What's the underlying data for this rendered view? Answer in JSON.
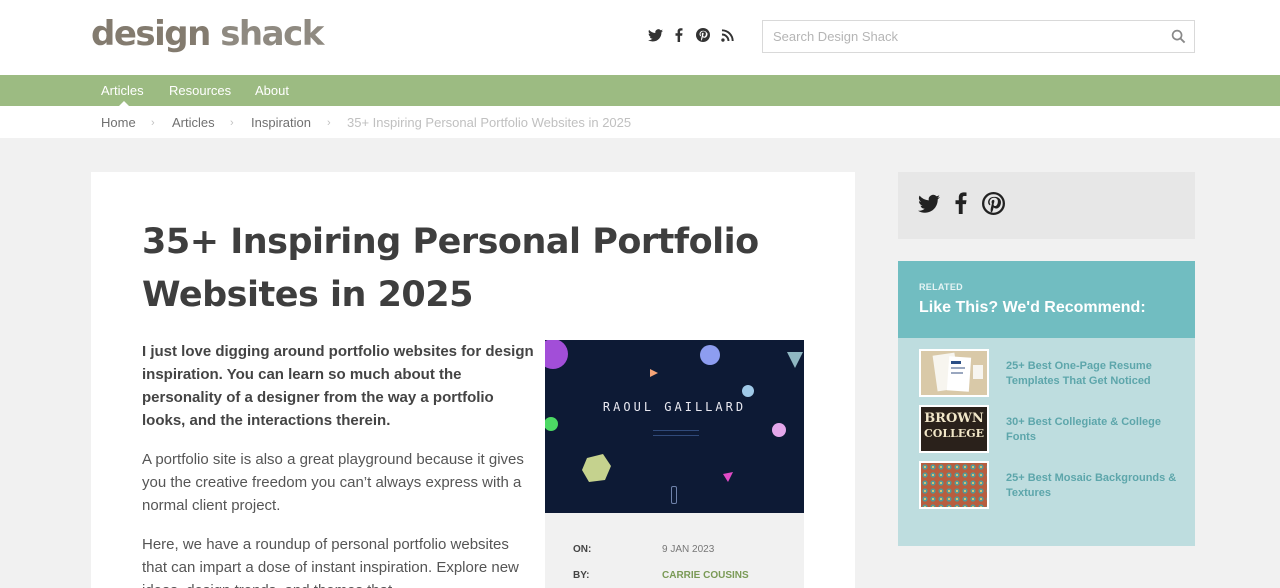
{
  "brand": {
    "logo_part1": "design",
    "logo_part2": "shack"
  },
  "social_icons": [
    "twitter-icon",
    "facebook-icon",
    "pinterest-icon",
    "rss-icon"
  ],
  "search": {
    "placeholder": "Search Design Shack"
  },
  "nav": {
    "items": [
      "Articles",
      "Resources",
      "About"
    ]
  },
  "breadcrumb": {
    "items": [
      "Home",
      "Articles",
      "Inspiration"
    ],
    "separator": "›",
    "current": "35+ Inspiring Personal Portfolio Websites in 2025"
  },
  "article": {
    "title": "35+ Inspiring Personal Portfolio Websites in 2025",
    "lead": "I just love digging around portfolio websites for design inspiration. You can learn so much about the personality of a designer from the way a portfolio looks, and the interactions therein.",
    "p1": "A portfolio site is also a great playground because it gives you the creative freedom you can’t always express with a normal client project.",
    "p2": "Here, we have a roundup of personal portfolio websites that can impart a dose of instant inspiration. Explore new ideas, design trends, and themes that",
    "feature_image_text": "RAOUL GAILLARD",
    "meta": {
      "on_label": "ON:",
      "on_value": "9 JAN 2023",
      "by_label": "BY:",
      "by_value": "CARRIE COUSINS"
    }
  },
  "sidebar": {
    "share_icons": [
      "twitter-icon",
      "facebook-icon",
      "pinterest-icon"
    ],
    "related": {
      "kicker": "RELATED",
      "title": "Like This? We'd Recommend:",
      "items": [
        {
          "label": "25+ Best One-Page Resume Templates That Get Noticed"
        },
        {
          "label": "30+ Best Collegiate & College Fonts",
          "thumb_text_1": "BROWN",
          "thumb_text_2": "COLLEGE"
        },
        {
          "label": "25+ Best Mosaic Backgrounds & Textures"
        }
      ]
    }
  },
  "colors": {
    "nav_green": "#9cbb82",
    "related_head": "#71bdc1",
    "related_body": "#bedddf",
    "author_green": "#7a9a56"
  }
}
